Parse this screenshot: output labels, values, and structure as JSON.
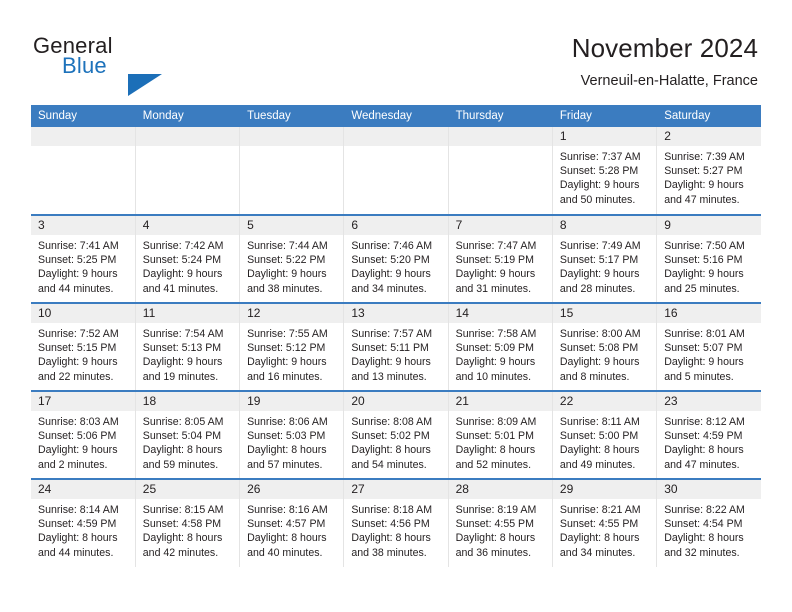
{
  "logo": {
    "word_one": "General",
    "word_two": "Blue",
    "triangle_color": "#1c6fb8"
  },
  "header": {
    "title": "November 2024",
    "subtitle": "Verneuil-en-Halatte, France",
    "accent_color": "#3b7cc0",
    "daynum_background": "#efefef"
  },
  "weekday_headers": [
    "Sunday",
    "Monday",
    "Tuesday",
    "Wednesday",
    "Thursday",
    "Friday",
    "Saturday"
  ],
  "weeks": [
    [
      {
        "day": "",
        "empty": true
      },
      {
        "day": "",
        "empty": true
      },
      {
        "day": "",
        "empty": true
      },
      {
        "day": "",
        "empty": true
      },
      {
        "day": "",
        "empty": true
      },
      {
        "day": "1",
        "sunrise": "Sunrise: 7:37 AM",
        "sunset": "Sunset: 5:28 PM",
        "daylight_1": "Daylight: 9 hours",
        "daylight_2": "and 50 minutes."
      },
      {
        "day": "2",
        "sunrise": "Sunrise: 7:39 AM",
        "sunset": "Sunset: 5:27 PM",
        "daylight_1": "Daylight: 9 hours",
        "daylight_2": "and 47 minutes."
      }
    ],
    [
      {
        "day": "3",
        "sunrise": "Sunrise: 7:41 AM",
        "sunset": "Sunset: 5:25 PM",
        "daylight_1": "Daylight: 9 hours",
        "daylight_2": "and 44 minutes."
      },
      {
        "day": "4",
        "sunrise": "Sunrise: 7:42 AM",
        "sunset": "Sunset: 5:24 PM",
        "daylight_1": "Daylight: 9 hours",
        "daylight_2": "and 41 minutes."
      },
      {
        "day": "5",
        "sunrise": "Sunrise: 7:44 AM",
        "sunset": "Sunset: 5:22 PM",
        "daylight_1": "Daylight: 9 hours",
        "daylight_2": "and 38 minutes."
      },
      {
        "day": "6",
        "sunrise": "Sunrise: 7:46 AM",
        "sunset": "Sunset: 5:20 PM",
        "daylight_1": "Daylight: 9 hours",
        "daylight_2": "and 34 minutes."
      },
      {
        "day": "7",
        "sunrise": "Sunrise: 7:47 AM",
        "sunset": "Sunset: 5:19 PM",
        "daylight_1": "Daylight: 9 hours",
        "daylight_2": "and 31 minutes."
      },
      {
        "day": "8",
        "sunrise": "Sunrise: 7:49 AM",
        "sunset": "Sunset: 5:17 PM",
        "daylight_1": "Daylight: 9 hours",
        "daylight_2": "and 28 minutes."
      },
      {
        "day": "9",
        "sunrise": "Sunrise: 7:50 AM",
        "sunset": "Sunset: 5:16 PM",
        "daylight_1": "Daylight: 9 hours",
        "daylight_2": "and 25 minutes."
      }
    ],
    [
      {
        "day": "10",
        "sunrise": "Sunrise: 7:52 AM",
        "sunset": "Sunset: 5:15 PM",
        "daylight_1": "Daylight: 9 hours",
        "daylight_2": "and 22 minutes."
      },
      {
        "day": "11",
        "sunrise": "Sunrise: 7:54 AM",
        "sunset": "Sunset: 5:13 PM",
        "daylight_1": "Daylight: 9 hours",
        "daylight_2": "and 19 minutes."
      },
      {
        "day": "12",
        "sunrise": "Sunrise: 7:55 AM",
        "sunset": "Sunset: 5:12 PM",
        "daylight_1": "Daylight: 9 hours",
        "daylight_2": "and 16 minutes."
      },
      {
        "day": "13",
        "sunrise": "Sunrise: 7:57 AM",
        "sunset": "Sunset: 5:11 PM",
        "daylight_1": "Daylight: 9 hours",
        "daylight_2": "and 13 minutes."
      },
      {
        "day": "14",
        "sunrise": "Sunrise: 7:58 AM",
        "sunset": "Sunset: 5:09 PM",
        "daylight_1": "Daylight: 9 hours",
        "daylight_2": "and 10 minutes."
      },
      {
        "day": "15",
        "sunrise": "Sunrise: 8:00 AM",
        "sunset": "Sunset: 5:08 PM",
        "daylight_1": "Daylight: 9 hours",
        "daylight_2": "and 8 minutes."
      },
      {
        "day": "16",
        "sunrise": "Sunrise: 8:01 AM",
        "sunset": "Sunset: 5:07 PM",
        "daylight_1": "Daylight: 9 hours",
        "daylight_2": "and 5 minutes."
      }
    ],
    [
      {
        "day": "17",
        "sunrise": "Sunrise: 8:03 AM",
        "sunset": "Sunset: 5:06 PM",
        "daylight_1": "Daylight: 9 hours",
        "daylight_2": "and 2 minutes."
      },
      {
        "day": "18",
        "sunrise": "Sunrise: 8:05 AM",
        "sunset": "Sunset: 5:04 PM",
        "daylight_1": "Daylight: 8 hours",
        "daylight_2": "and 59 minutes."
      },
      {
        "day": "19",
        "sunrise": "Sunrise: 8:06 AM",
        "sunset": "Sunset: 5:03 PM",
        "daylight_1": "Daylight: 8 hours",
        "daylight_2": "and 57 minutes."
      },
      {
        "day": "20",
        "sunrise": "Sunrise: 8:08 AM",
        "sunset": "Sunset: 5:02 PM",
        "daylight_1": "Daylight: 8 hours",
        "daylight_2": "and 54 minutes."
      },
      {
        "day": "21",
        "sunrise": "Sunrise: 8:09 AM",
        "sunset": "Sunset: 5:01 PM",
        "daylight_1": "Daylight: 8 hours",
        "daylight_2": "and 52 minutes."
      },
      {
        "day": "22",
        "sunrise": "Sunrise: 8:11 AM",
        "sunset": "Sunset: 5:00 PM",
        "daylight_1": "Daylight: 8 hours",
        "daylight_2": "and 49 minutes."
      },
      {
        "day": "23",
        "sunrise": "Sunrise: 8:12 AM",
        "sunset": "Sunset: 4:59 PM",
        "daylight_1": "Daylight: 8 hours",
        "daylight_2": "and 47 minutes."
      }
    ],
    [
      {
        "day": "24",
        "sunrise": "Sunrise: 8:14 AM",
        "sunset": "Sunset: 4:59 PM",
        "daylight_1": "Daylight: 8 hours",
        "daylight_2": "and 44 minutes."
      },
      {
        "day": "25",
        "sunrise": "Sunrise: 8:15 AM",
        "sunset": "Sunset: 4:58 PM",
        "daylight_1": "Daylight: 8 hours",
        "daylight_2": "and 42 minutes."
      },
      {
        "day": "26",
        "sunrise": "Sunrise: 8:16 AM",
        "sunset": "Sunset: 4:57 PM",
        "daylight_1": "Daylight: 8 hours",
        "daylight_2": "and 40 minutes."
      },
      {
        "day": "27",
        "sunrise": "Sunrise: 8:18 AM",
        "sunset": "Sunset: 4:56 PM",
        "daylight_1": "Daylight: 8 hours",
        "daylight_2": "and 38 minutes."
      },
      {
        "day": "28",
        "sunrise": "Sunrise: 8:19 AM",
        "sunset": "Sunset: 4:55 PM",
        "daylight_1": "Daylight: 8 hours",
        "daylight_2": "and 36 minutes."
      },
      {
        "day": "29",
        "sunrise": "Sunrise: 8:21 AM",
        "sunset": "Sunset: 4:55 PM",
        "daylight_1": "Daylight: 8 hours",
        "daylight_2": "and 34 minutes."
      },
      {
        "day": "30",
        "sunrise": "Sunrise: 8:22 AM",
        "sunset": "Sunset: 4:54 PM",
        "daylight_1": "Daylight: 8 hours",
        "daylight_2": "and 32 minutes."
      }
    ]
  ]
}
